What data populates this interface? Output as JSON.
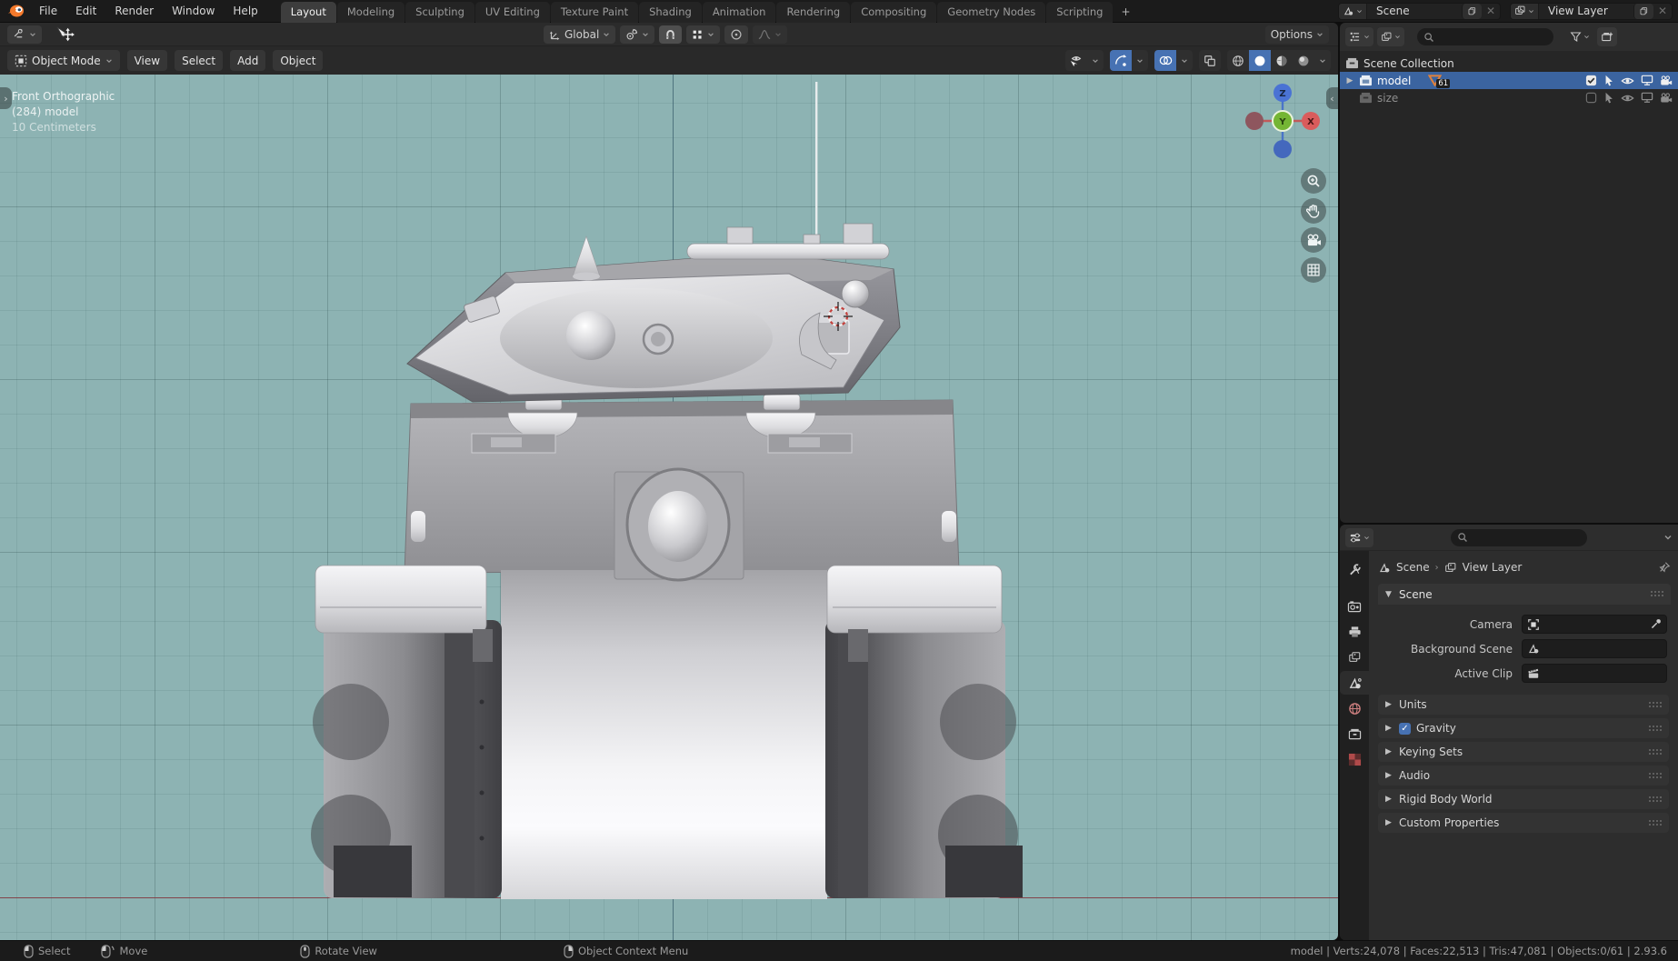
{
  "colors": {
    "accent": "#4772b3",
    "selection_blue": "#3b64a0",
    "viewport_bg": "#8db3b3",
    "floor_line": "#853840",
    "axis_x": "#d95c5c",
    "axis_y": "#74b534",
    "axis_z": "#4a73d4",
    "badge_orange": "#e0813c"
  },
  "topbar": {
    "menus": [
      "File",
      "Edit",
      "Render",
      "Window",
      "Help"
    ],
    "workspaces": [
      "Layout",
      "Modeling",
      "Sculpting",
      "UV Editing",
      "Texture Paint",
      "Shading",
      "Animation",
      "Rendering",
      "Compositing",
      "Geometry Nodes",
      "Scripting"
    ],
    "add_tab": "+",
    "scene_selector": {
      "value": "Scene",
      "close": "✕"
    },
    "view_layer_selector": {
      "value": "View Layer",
      "close": "✕"
    }
  },
  "tool_settings": {
    "orientation": "Global",
    "options_label": "Options"
  },
  "viewport_header": {
    "mode": "Object Mode",
    "menus": [
      "View",
      "Select",
      "Add",
      "Object"
    ]
  },
  "viewport": {
    "overlay_lines": [
      "Front Orthographic",
      "(284) model",
      "10 Centimeters"
    ],
    "axis_labels": {
      "x": "X",
      "y": "Y",
      "z": "Z"
    },
    "collapse_left": "›",
    "collapse_right": "‹"
  },
  "outliner": {
    "root_label": "Scene Collection",
    "items": [
      {
        "label": "model",
        "badge": "61"
      },
      {
        "label": "size"
      }
    ]
  },
  "properties": {
    "breadcrumb": {
      "scene": "Scene",
      "separator": "›",
      "view_layer": "View Layer"
    },
    "scene_panel": {
      "title": "Scene",
      "fields": [
        {
          "label": "Camera"
        },
        {
          "label": "Background Scene"
        },
        {
          "label": "Active Clip"
        }
      ]
    },
    "collapsed_panels": [
      {
        "label": "Units"
      },
      {
        "label": "Gravity",
        "checked": "✓"
      },
      {
        "label": "Keying Sets"
      },
      {
        "label": "Audio"
      },
      {
        "label": "Rigid Body World"
      },
      {
        "label": "Custom Properties"
      }
    ]
  },
  "status_bar": {
    "hints": [
      {
        "label": "Select"
      },
      {
        "label": "Move"
      },
      {
        "label": "Rotate View"
      },
      {
        "label": "Object Context Menu"
      }
    ],
    "stats": "model | Verts:24,078 | Faces:22,513 | Tris:47,081 | Objects:0/61 | 2.93.6"
  }
}
